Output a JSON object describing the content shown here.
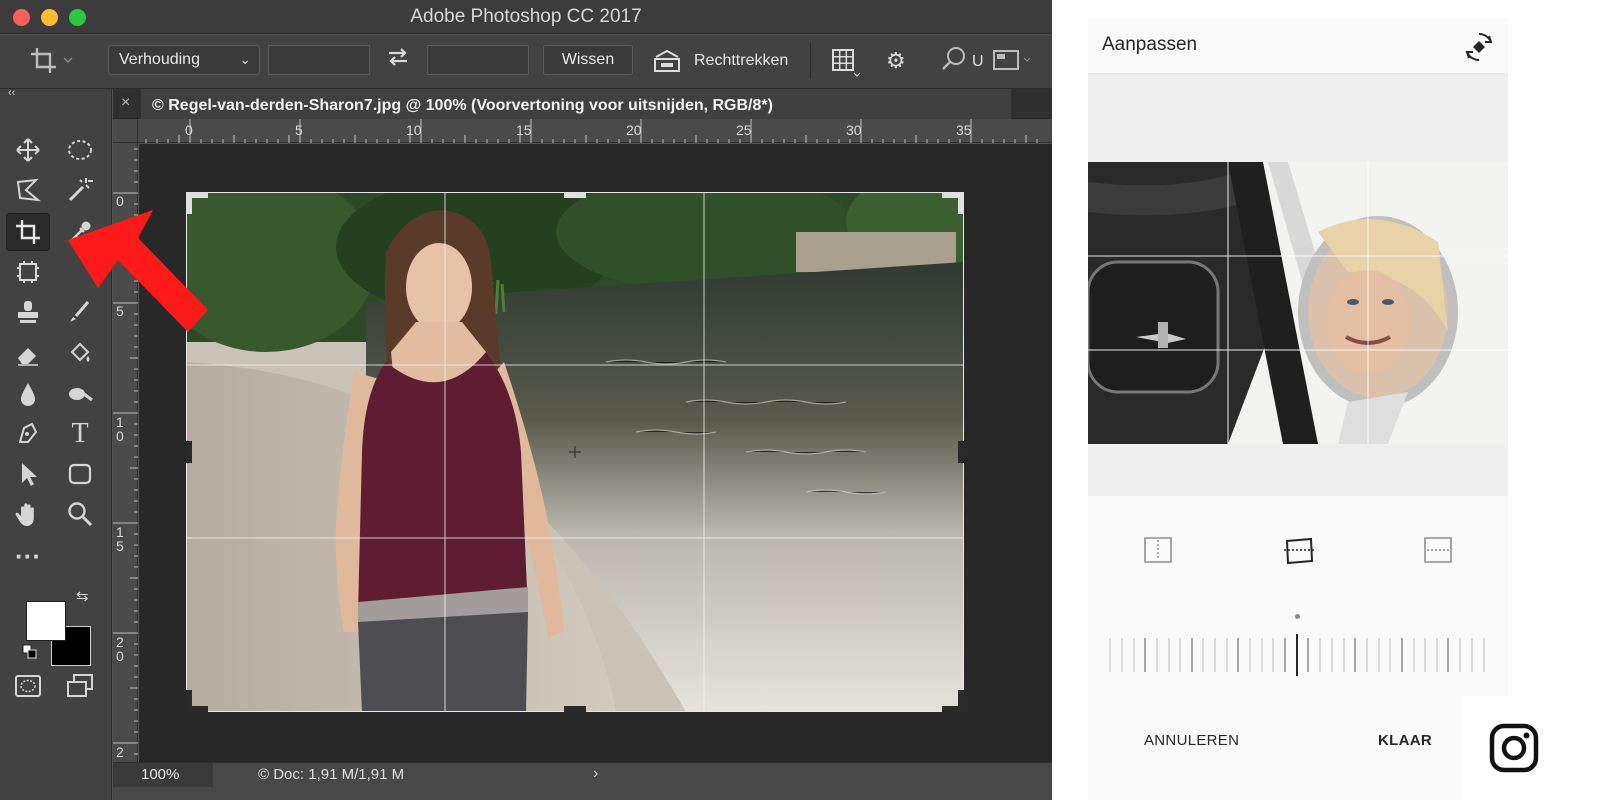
{
  "photoshop": {
    "window_title": "Adobe Photoshop CC 2017",
    "options_bar": {
      "ratio_select": "Verhouding",
      "width_value": "",
      "height_value": "",
      "clear_button": "Wissen",
      "straighten_button": "Rechttrekken",
      "search_fragment": "U"
    },
    "document_tab": {
      "title": "© Regel-van-derden-Sharon7.jpg @ 100% (Voorvertoning voor uitsnijden, RGB/8*)",
      "close": "×"
    },
    "ruler_h_labels": [
      "0",
      "5",
      "10",
      "15",
      "20",
      "25",
      "30",
      "35"
    ],
    "ruler_v_labels": [
      "0",
      "5",
      "1\n0",
      "1\n5",
      "2\n0",
      "2"
    ],
    "status": {
      "zoom": "100%",
      "doc_size": "© Doc: 1,91 M/1,91 M",
      "arrow": "›"
    },
    "toolbar_collapse": "‹‹",
    "colors": {
      "foreground": "#ffffff",
      "background": "#000000",
      "arrow_annotation": "#ff0000"
    }
  },
  "instagram": {
    "header_title": "Aanpassen",
    "cancel_label": "ANNULEREN",
    "done_label": "KLAAR",
    "selected_perspective": "horizontal"
  }
}
